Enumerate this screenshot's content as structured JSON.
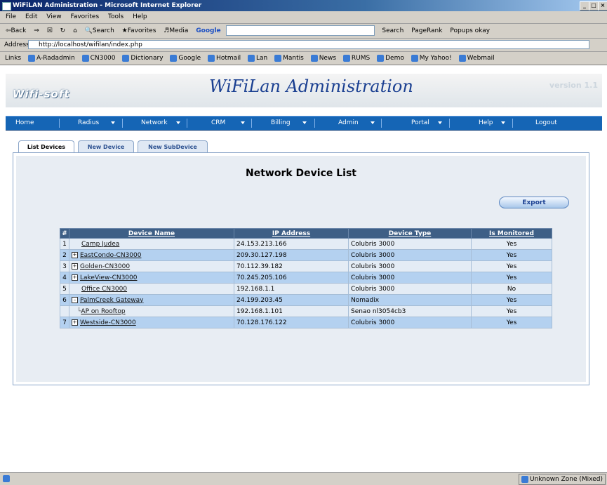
{
  "window": {
    "title": "WiFiLAN Administration - Microsoft Internet Explorer",
    "controls": [
      "_",
      "□",
      "×"
    ]
  },
  "menu": [
    "File",
    "Edit",
    "View",
    "Favorites",
    "Tools",
    "Help"
  ],
  "toolbar": {
    "back": "⇦Back",
    "search": "Search",
    "favorites": "Favorites",
    "media": "Media",
    "google": "Google",
    "search2": "Search",
    "pagerank": "PageRank",
    "popups": "Popups okay"
  },
  "addressbar": {
    "label": "Address",
    "url": "http://localhost/wifilan/index.php"
  },
  "links": {
    "label": "Links",
    "items": [
      "A-Radadmin",
      "CN3000",
      "Dictionary",
      "Google",
      "Hotmail",
      "Lan",
      "Mantis",
      "News",
      "RUMS",
      "Demo",
      "My Yahoo!",
      "Webmail"
    ]
  },
  "header": {
    "logo": "Wifi-soft",
    "title": "WiFiLan Administration",
    "version": "version 1.1"
  },
  "nav": [
    {
      "label": "Home",
      "dropdown": false
    },
    {
      "label": "Radius",
      "dropdown": true
    },
    {
      "label": "Network",
      "dropdown": true
    },
    {
      "label": "CRM",
      "dropdown": true
    },
    {
      "label": "Billing",
      "dropdown": true
    },
    {
      "label": "Admin",
      "dropdown": true
    },
    {
      "label": "Portal",
      "dropdown": true
    },
    {
      "label": "Help",
      "dropdown": true
    },
    {
      "label": "Logout",
      "dropdown": false
    }
  ],
  "tabs": [
    {
      "label": "List Devices",
      "active": true
    },
    {
      "label": "New Device",
      "active": false
    },
    {
      "label": "New SubDevice",
      "active": false
    }
  ],
  "page": {
    "title": "Network Device List",
    "export_label": "Export"
  },
  "table": {
    "headers": [
      "#",
      "Device Name",
      "IP Address",
      "Device Type",
      "Is Monitored"
    ],
    "rows": [
      {
        "num": "1",
        "expander": "",
        "name": "Camp Judea",
        "ip": "24.153.213.166",
        "type": "Colubris 3000",
        "monitored": "Yes"
      },
      {
        "num": "2",
        "expander": "⊞",
        "name": "EastCondo-CN3000",
        "ip": "209.30.127.198",
        "type": "Colubris 3000",
        "monitored": "Yes"
      },
      {
        "num": "3",
        "expander": "⊞",
        "name": "Golden-CN3000",
        "ip": "70.112.39.182",
        "type": "Colubris 3000",
        "monitored": "Yes"
      },
      {
        "num": "4",
        "expander": "⊞",
        "name": "LakeView-CN3000",
        "ip": "70.245.205.106",
        "type": "Colubris 3000",
        "monitored": "Yes"
      },
      {
        "num": "5",
        "expander": "",
        "name": "Office CN3000",
        "ip": "192.168.1.1",
        "type": "Colubris 3000",
        "monitored": "No"
      },
      {
        "num": "6",
        "expander": "⊟",
        "name": "PalmCreek Gateway",
        "ip": "24.199.203.45",
        "type": "Nomadix",
        "monitored": "Yes"
      },
      {
        "num": "",
        "expander": "└",
        "name": "AP on Rooftop",
        "ip": "192.168.1.101",
        "type": "Senao nl3054cb3",
        "monitored": "Yes"
      },
      {
        "num": "7",
        "expander": "⊞",
        "name": "Westside-CN3000",
        "ip": "70.128.176.122",
        "type": "Colubris 3000",
        "monitored": "Yes"
      }
    ]
  },
  "status": {
    "zone": "Unknown Zone (Mixed)"
  },
  "colors": {
    "nav": "#1565b5",
    "header_row": "#3e5f86",
    "row_even": "#b4d1f0",
    "row_odd": "#e4ecf5",
    "title": "#1a3f91"
  }
}
